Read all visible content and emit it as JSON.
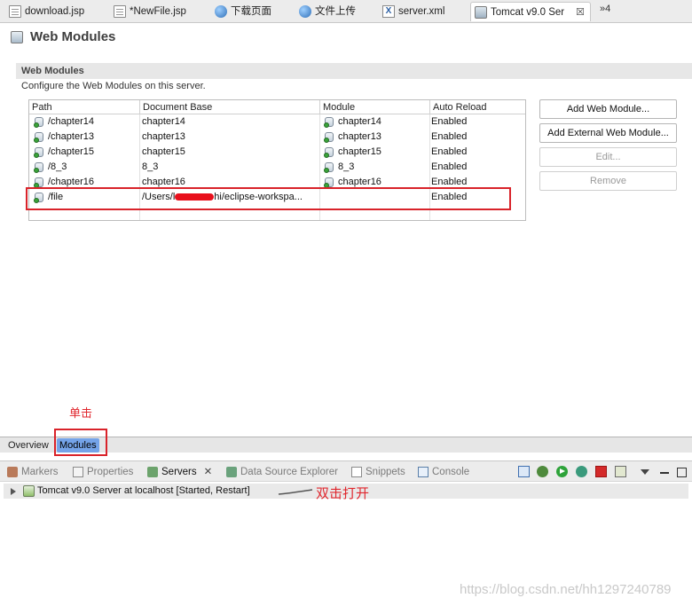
{
  "tabs": [
    {
      "label": "download.jsp",
      "icon": "jsp-file-icon"
    },
    {
      "label": "*NewFile.jsp",
      "icon": "jsp-file-icon"
    },
    {
      "label": "下载页面",
      "icon": "web-page-icon"
    },
    {
      "label": "文件上传",
      "icon": "web-page-icon"
    },
    {
      "label": "server.xml",
      "icon": "xml-file-icon"
    },
    {
      "label": "Tomcat v9.0 Ser",
      "icon": "server-icon",
      "active": true
    }
  ],
  "tabs_more": "»4",
  "page": {
    "title": "Web Modules"
  },
  "section": {
    "title": "Web Modules",
    "description": "Configure the Web Modules on this server."
  },
  "table": {
    "columns": [
      "Path",
      "Document Base",
      "Module",
      "Auto Reload"
    ],
    "rows": [
      {
        "path": "/chapter14",
        "doc_base": "chapter14",
        "module": "chapter14",
        "auto_reload": "Enabled"
      },
      {
        "path": "/chapter13",
        "doc_base": "chapter13",
        "module": "chapter13",
        "auto_reload": "Enabled"
      },
      {
        "path": "/chapter15",
        "doc_base": "chapter15",
        "module": "chapter15",
        "auto_reload": "Enabled"
      },
      {
        "path": "/8_3",
        "doc_base": "8_3",
        "module": "8_3",
        "auto_reload": "Enabled"
      },
      {
        "path": "/chapter16",
        "doc_base": "chapter16",
        "module": "chapter16",
        "auto_reload": "Enabled"
      },
      {
        "path": "/file",
        "doc_base_prefix": "/Users/l",
        "doc_base_suffix": "hi/eclipse-workspa...",
        "module": "",
        "auto_reload": "Enabled"
      }
    ]
  },
  "buttons": {
    "add": "Add Web Module...",
    "add_external": "Add External Web Module...",
    "edit": "Edit...",
    "remove": "Remove"
  },
  "annotations": {
    "single_click": "单击",
    "double_click": "双击打开",
    "accent_color": "#e0262d"
  },
  "form_tabs": {
    "overview": "Overview",
    "modules": "Modules"
  },
  "views": {
    "tabs": [
      "Markers",
      "Properties",
      "Servers",
      "Data Source Explorer",
      "Snippets",
      "Console"
    ],
    "active": "Servers",
    "close_glyph": "✕"
  },
  "server": {
    "label": "Tomcat v9.0 Server at localhost  [Started, Restart]"
  },
  "watermark": "https://blog.csdn.net/hh1297240789"
}
